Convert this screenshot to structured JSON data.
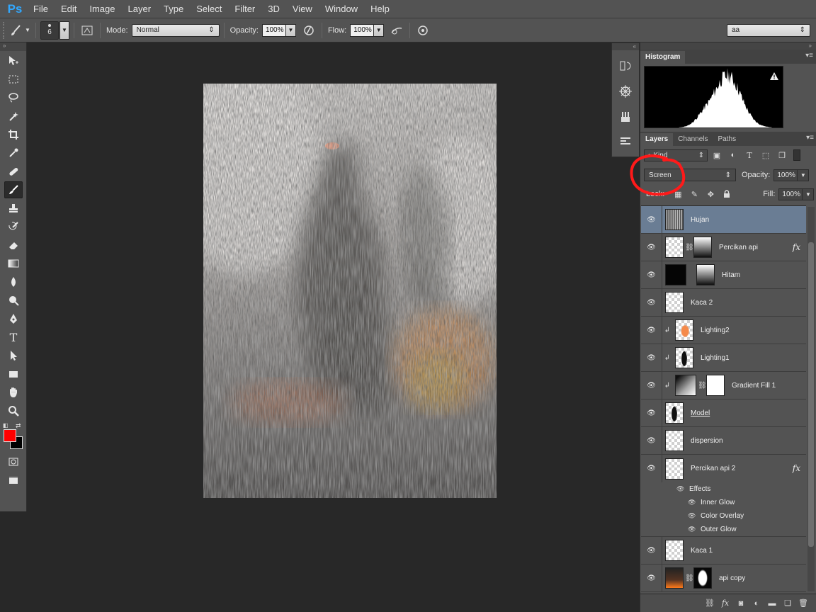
{
  "app": {
    "logo": "Ps"
  },
  "menu": [
    "File",
    "Edit",
    "Image",
    "Layer",
    "Type",
    "Select",
    "Filter",
    "3D",
    "View",
    "Window",
    "Help"
  ],
  "options": {
    "brush_size": "6",
    "mode_label": "Mode:",
    "mode_value": "Normal",
    "opacity_label": "Opacity:",
    "opacity_value": "100%",
    "flow_label": "Flow:",
    "flow_value": "100%",
    "workspace": "aa"
  },
  "colors": {
    "foreground": "#ff0000",
    "background": "#000000",
    "selected_layer": "#6a7d94",
    "annotation": "#ff1a1a"
  },
  "histogram": {
    "tab": "Histogram",
    "warning_icon": "warning-icon"
  },
  "layers_panel": {
    "tabs": [
      "Layers",
      "Channels",
      "Paths"
    ],
    "filter_kind": "Kind",
    "blend_mode": "Screen",
    "opacity_label": "Opacity:",
    "opacity_value": "100%",
    "lock_label": "Lock:",
    "fill_label": "Fill:",
    "fill_value": "100%",
    "layers": [
      {
        "name": "Hujan"
      },
      {
        "name": "Percikan api",
        "fx": "fx"
      },
      {
        "name": "Hitam"
      },
      {
        "name": "Kaca 2"
      },
      {
        "name": "Lighting2"
      },
      {
        "name": "Lighting1"
      },
      {
        "name": "Gradient Fill 1"
      },
      {
        "name": "Model"
      },
      {
        "name": "dispersion"
      },
      {
        "name": "Percikan api 2",
        "fx": "fx"
      },
      {
        "name": "Kaca 1"
      },
      {
        "name": "api copy"
      }
    ],
    "effects_label": "Effects",
    "effects": [
      "Inner Glow",
      "Color Overlay",
      "Outer Glow"
    ]
  }
}
